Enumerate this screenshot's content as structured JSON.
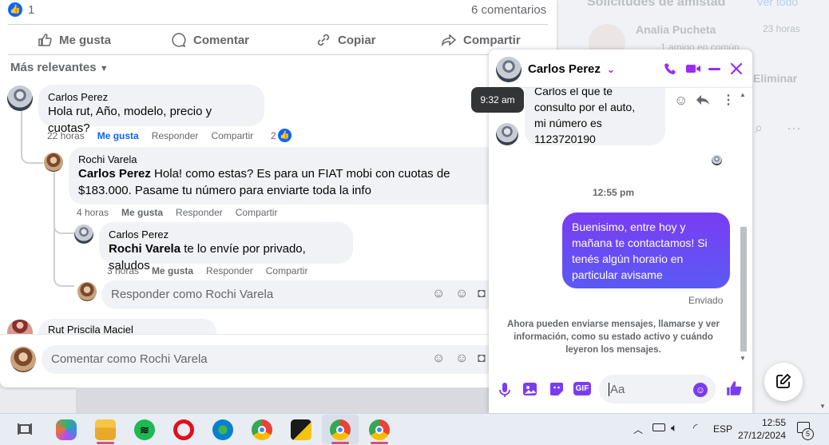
{
  "background": {
    "friend_requests_title": "Solicitudes de amistad",
    "see_all": "Ver todo",
    "requester_name": "Analia Pucheta",
    "requester_time": "23 horas",
    "requester_sub": "1 amigo en común",
    "delete_label": "Eliminar"
  },
  "post": {
    "like_count": "1",
    "comments_count": "6 comentarios",
    "actions": {
      "like": "Me gusta",
      "comment": "Comentar",
      "copy": "Copiar",
      "share": "Compartir"
    },
    "sort_label": "Más relevantes",
    "comments": [
      {
        "author": "Carlos Perez",
        "text": "Hola rut, Año, modelo, precio y cuotas?",
        "time": "22 horas",
        "like": "Me gusta",
        "reply": "Responder",
        "share": "Compartir",
        "reactions": "2"
      },
      {
        "author": "Rochi Varela",
        "mention": "Carlos Perez",
        "text": " Hola! como estas? Es para un FIAT mobi con cuotas de $183.000. Pasame tu número para enviarte toda la info",
        "time": "4 horas",
        "like": "Me gusta",
        "reply": "Responder",
        "share": "Compartir"
      },
      {
        "author": "Carlos Perez",
        "mention": "Rochi Varela",
        "text": " te lo envíe por privado, saludos",
        "time": "3 horas",
        "like": "Me gusta",
        "reply": "Responder",
        "share": "Compartir"
      },
      {
        "author": "Rut Priscila Maciel"
      }
    ],
    "reply_placeholder": "Responder como Rochi Varela",
    "comment_placeholder": "Comentar como Rochi Varela"
  },
  "chat": {
    "contact_name": "Carlos Perez",
    "tooltip_time": "9:32 am",
    "incoming_message": "Carlos el que te consulto por el auto, mi número es 1123720190",
    "incoming_line1": "Carlos el que te",
    "incoming_line2": "consulto por el auto,",
    "incoming_line3": "mi número es",
    "incoming_line4": "1123720190",
    "timestamp": "12:55 pm",
    "outgoing_message": "Buenisimo, entre hoy y mañana te contactamos! Si tenés algún horario en particular avisame",
    "status": "Enviado",
    "notice": "Ahora pueden enviarse mensajes, llamarse y ver información, como su estado activo y cuándo leyeron los mensajes.",
    "input_placeholder": "Aa",
    "gif_label": "GIF"
  },
  "taskbar": {
    "language": "ESP",
    "time": "12:55",
    "date": "27/12/2024",
    "notification_count": "5"
  },
  "colors": {
    "messenger_purple": "#9b2cf5",
    "facebook_blue": "#0866ff",
    "outgoing_gradient_start": "#7a3cf2",
    "outgoing_gradient_end": "#5b5af5"
  }
}
